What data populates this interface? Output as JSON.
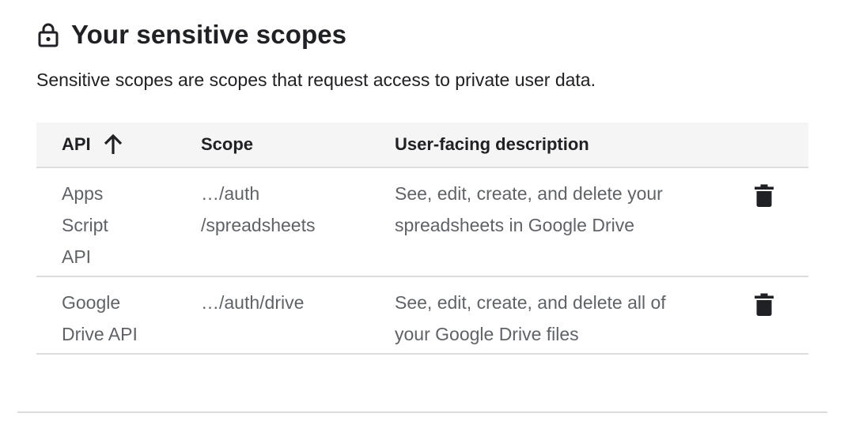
{
  "section": {
    "title": "Your sensitive scopes",
    "title_icon": "lock-icon",
    "description": "Sensitive scopes are scopes that request access to private user data."
  },
  "table": {
    "columns": {
      "api": "API",
      "scope": "Scope",
      "description": "User-facing description"
    },
    "sort": {
      "column": "api",
      "direction": "ascending",
      "icon": "arrow-up-icon"
    },
    "rows": [
      {
        "api": [
          "Apps",
          "Script",
          "API"
        ],
        "scope": [
          "…/auth",
          "/spreadsheets"
        ],
        "description": [
          "See, edit, create, and delete your",
          "spreadsheets in Google Drive"
        ],
        "action_icon": "trash-icon"
      },
      {
        "api": [
          "Google",
          "Drive API"
        ],
        "scope": [
          "…/auth/drive"
        ],
        "description": [
          "See, edit, create, and delete all of",
          "your Google Drive files"
        ],
        "action_icon": "trash-icon"
      }
    ]
  },
  "colors": {
    "header_bg": "#f5f5f5",
    "divider": "#dadce0",
    "primary_text": "#202124",
    "secondary_text": "#5f6368"
  }
}
